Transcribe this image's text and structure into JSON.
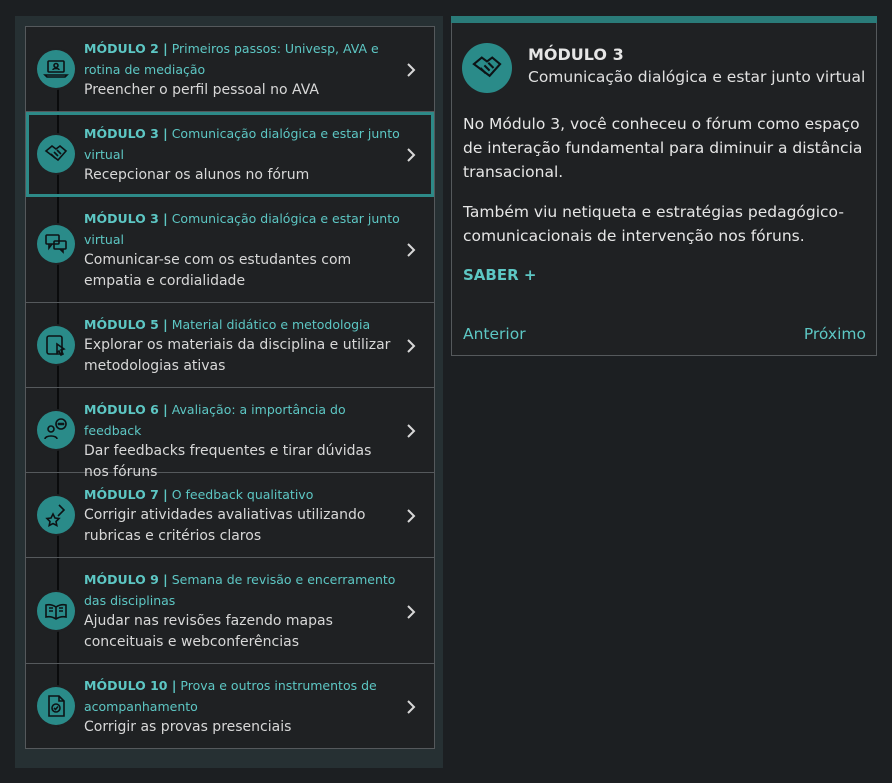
{
  "modules": [
    {
      "num": "MÓDULO 2 |",
      "title": "Primeiros passos: Univesp, AVA e rotina de mediação",
      "task": "Preencher o perfil pessoal no AVA",
      "icon": "laptop-icon",
      "active": false
    },
    {
      "num": "MÓDULO 3 |",
      "title": "Comunicação dialógica e estar junto virtual",
      "task": "Recepcionar os alunos no fórum",
      "icon": "handshake-icon",
      "active": true
    },
    {
      "num": "MÓDULO 3 |",
      "title": "Comunicação dialógica e estar junto virtual",
      "task": "Comunicar-se com os estudantes com empatia e cordialidade",
      "icon": "chat-bubbles-icon",
      "active": false
    },
    {
      "num": "MÓDULO 5 |",
      "title": "Material didático e metodologia",
      "task": "Explorar os materiais da disciplina e utilizar metodologias ativas",
      "icon": "tablet-cursor-icon",
      "active": false
    },
    {
      "num": "MÓDULO 6 |",
      "title": "Avaliação: a importância do feedback",
      "task": "Dar feedbacks frequentes e tirar dúvidas nos fóruns",
      "icon": "person-speech-icon",
      "active": false
    },
    {
      "num": "MÓDULO 7 |",
      "title": "O feedback qualitativo",
      "task": "Corrigir atividades avaliativas utilizando rubricas e critérios claros",
      "icon": "star-pen-icon",
      "active": false
    },
    {
      "num": "MÓDULO 9 |",
      "title": "Semana de revisão e encerramento das disciplinas",
      "task": "Ajudar nas revisões fazendo mapas conceituais e webconferências",
      "icon": "open-book-icon",
      "active": false
    },
    {
      "num": "MÓDULO 10 |",
      "title": "Prova e outros instrumentos de acompanhamento",
      "task": "Corrigir as provas presenciais",
      "icon": "document-check-icon",
      "active": false
    }
  ],
  "detail": {
    "title": "MÓDULO 3",
    "subtitle": "Comunicação dialógica e estar junto virtual",
    "paragraph1": "No Módulo 3, você conheceu o fórum como espaço de interação fundamental para diminuir a distância transacional.",
    "paragraph2": "Também viu netiqueta e estratégias pedagógico-comunicacionais de intervenção nos fóruns.",
    "saber_label": "SABER +",
    "prev_label": "Anterior",
    "next_label": "Próximo",
    "icon": "handshake-icon"
  },
  "colors": {
    "accent": "#5dc7c4",
    "icon_bg": "#2a8b89",
    "active_border": "#2d8a88",
    "background": "#1c1f22"
  }
}
